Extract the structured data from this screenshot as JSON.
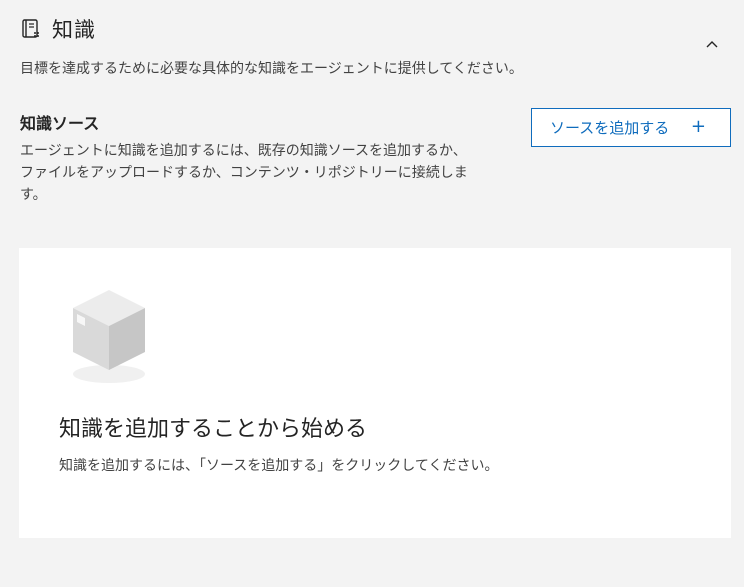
{
  "header": {
    "title": "知識",
    "icon": "book-icon",
    "collapse_icon": "chevron-up-icon"
  },
  "description": "目標を達成するために必要な具体的な知識をエージェントに提供してください。",
  "knowledge_sources": {
    "title": "知識ソース",
    "description": "エージェントに知識を追加するには、既存の知識ソースを追加するか、ファイルをアップロードするか、コンテンツ・リポジトリーに接続します。",
    "add_button_label": "ソースを追加する",
    "add_button_icon": "plus-icon",
    "add_button_plus": "+"
  },
  "empty_state": {
    "illustration": "box-icon",
    "title": "知識を追加することから始める",
    "description": "知識を追加するには、「ソースを追加する」をクリックしてください。"
  },
  "colors": {
    "accent": "#0f6cbd",
    "page_background": "#f3f3f3",
    "card_background": "#ffffff"
  }
}
